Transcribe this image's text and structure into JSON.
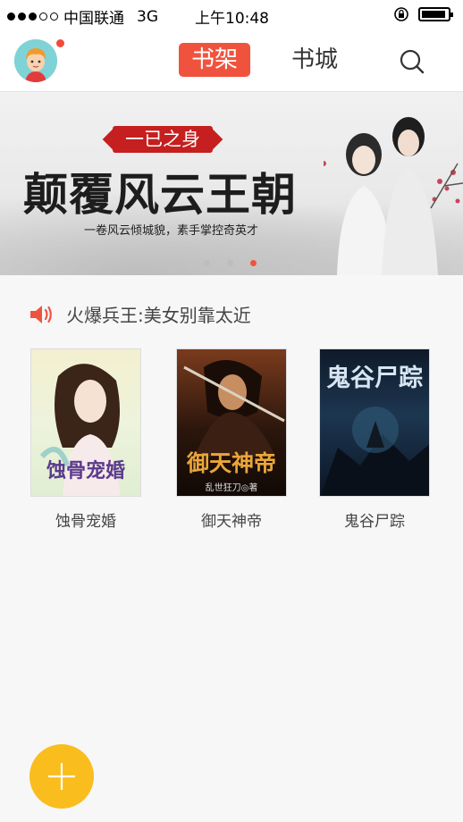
{
  "status_bar": {
    "carrier": "中国联通",
    "network": "3G",
    "time": "上午10:48"
  },
  "nav": {
    "tab_shelf": "书架",
    "tab_store": "书城",
    "icons": [
      "avatar",
      "search-icon"
    ]
  },
  "banner": {
    "tag": "一已之身",
    "title": "颠覆风云王朝",
    "subtitle": "一卷风云倾城貌，素手掌控奇英才",
    "page_count": 3,
    "active_page": 3
  },
  "notice": {
    "icon": "speaker-icon",
    "text": "火爆兵王:美女别靠太近"
  },
  "books": [
    {
      "title": "蚀骨宠婚",
      "cover_text": "蚀骨宠婚"
    },
    {
      "title": "御天神帝",
      "cover_text": "御天神帝",
      "cover_author": "乱世狂刀◎著"
    },
    {
      "title": "鬼谷尸踪",
      "cover_text": "鬼谷尸踪"
    }
  ],
  "fab": {
    "icon": "plus-icon"
  },
  "colors": {
    "accent": "#f0533d",
    "fab": "#f9bd1d"
  }
}
